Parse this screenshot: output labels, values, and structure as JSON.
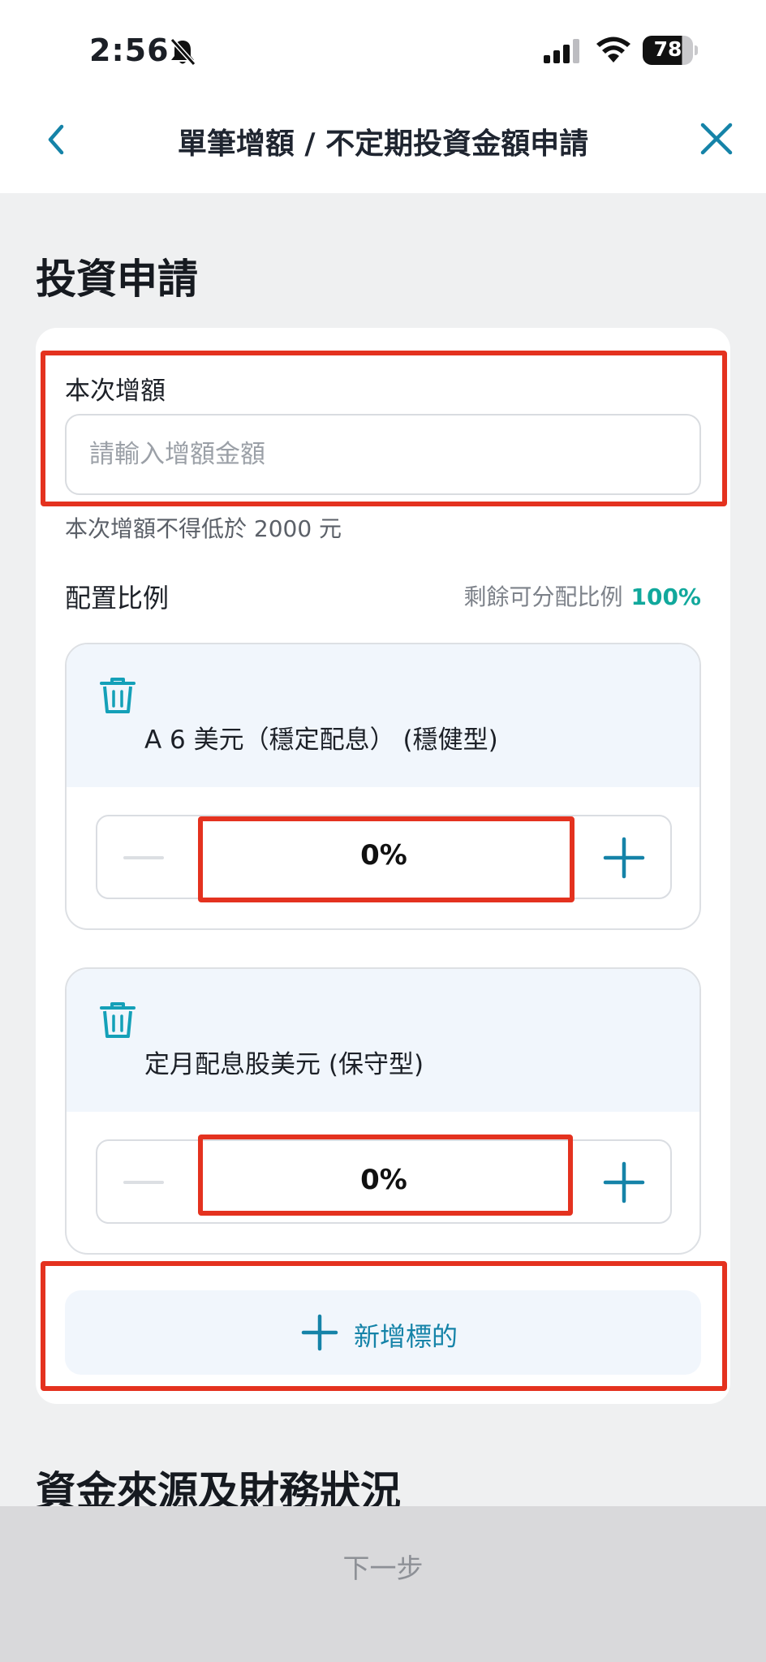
{
  "status_bar": {
    "time": "2:56",
    "battery": "78",
    "icons": [
      "bell-slash-icon",
      "signal-icon",
      "wifi-icon",
      "battery-icon"
    ]
  },
  "nav": {
    "title": "單筆增額 / 不定期投資金額申請",
    "back_icon": "chevron-left-icon",
    "close_icon": "close-icon"
  },
  "investment": {
    "section_title": "投資申請",
    "amount_label": "本次增額",
    "amount_placeholder": "請輸入增額金額",
    "amount_value": "",
    "amount_hint": "本次增額不得低於 2000 元",
    "ratio_label": "配置比例",
    "remaining_label": "剩餘可分配比例",
    "remaining_value": "100%",
    "funds": [
      {
        "name": "A 6 美元（穩定配息） (穩健型)",
        "ratio": "0%"
      },
      {
        "name": "定月配息股美元 (保守型)",
        "ratio": "0%"
      }
    ],
    "add_label": "新增標的"
  },
  "next_section_title": "資金來源及財務狀況",
  "footer": {
    "next_label": "下一步"
  },
  "colors": {
    "accent": "#1583a8",
    "teal": "#11a89c",
    "highlight": "#e4321f",
    "page_bg": "#eff0f1",
    "tint": "#f1f6fc"
  }
}
